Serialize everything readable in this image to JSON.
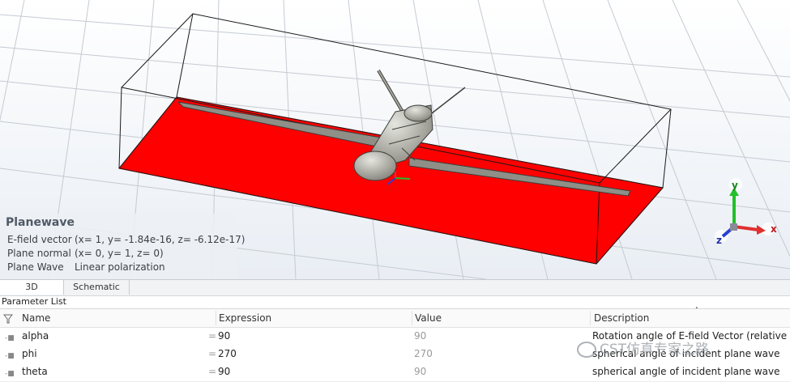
{
  "info": {
    "title": "Planewave",
    "rows": [
      {
        "label": "E-field vector",
        "value": "(x= 1, y= -1.84e-16, z= -6.12e-17)"
      },
      {
        "label": "Plane normal",
        "value": "(x= 0, y= 1, z= 0)"
      },
      {
        "label": "Plane Wave",
        "value": "Linear polarization"
      }
    ]
  },
  "tabs": [
    "3D",
    "Schematic"
  ],
  "parameter_list": {
    "title": "Parameter List",
    "columns": [
      "Name",
      "Expression",
      "Value",
      "Description"
    ],
    "rows": [
      {
        "name": "alpha",
        "expression": "90",
        "value": "90",
        "description": "Rotation angle of E-field Vector (relative to x-a"
      },
      {
        "name": "phi",
        "expression": "270",
        "value": "270",
        "description": "spherical angle of incident plane wave"
      },
      {
        "name": "theta",
        "expression": "90",
        "value": "90",
        "description": "spherical angle of incident plane wave"
      }
    ]
  },
  "axis_labels": {
    "x": "x",
    "y": "y",
    "z": "z"
  },
  "watermark": "CST仿真专家之路",
  "colors": {
    "plane": "#ff0000",
    "axis_x": "#e03030",
    "axis_y": "#22c02a",
    "axis_z": "#2a40d0"
  },
  "icons": {
    "filter": "filter-icon",
    "parameter": "parameter-icon",
    "collapse": "chevron-up-icon"
  }
}
